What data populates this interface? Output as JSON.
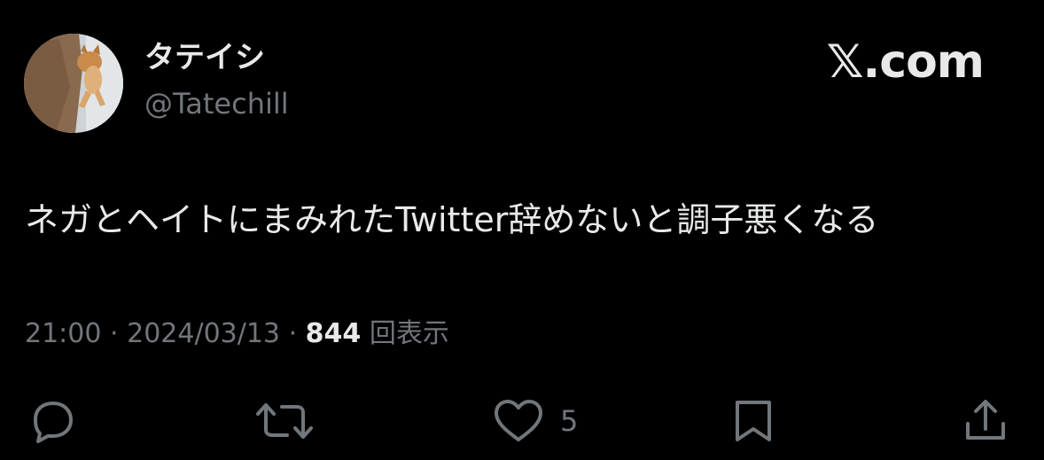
{
  "user": {
    "display_name": "タテイシ",
    "handle": "@Tatechill",
    "avatar_icon": "avatar-photo-dog"
  },
  "brand": {
    "label": "𝕏.com"
  },
  "tweet": {
    "text": "ネガとヘイトにまみれたTwitter辞めないと調子悪くなる",
    "time": "21:00",
    "separator": "·",
    "date": "2024/03/13",
    "views_count": "844",
    "views_label": "回表示"
  },
  "actions": {
    "reply_icon": "reply-icon",
    "retweet_icon": "retweet-icon",
    "like_icon": "heart-icon",
    "like_count": "5",
    "bookmark_icon": "bookmark-icon",
    "share_icon": "share-icon"
  },
  "colors": {
    "background": "#000000",
    "primary_text": "#e7e9ea",
    "secondary_text": "#71767b"
  }
}
